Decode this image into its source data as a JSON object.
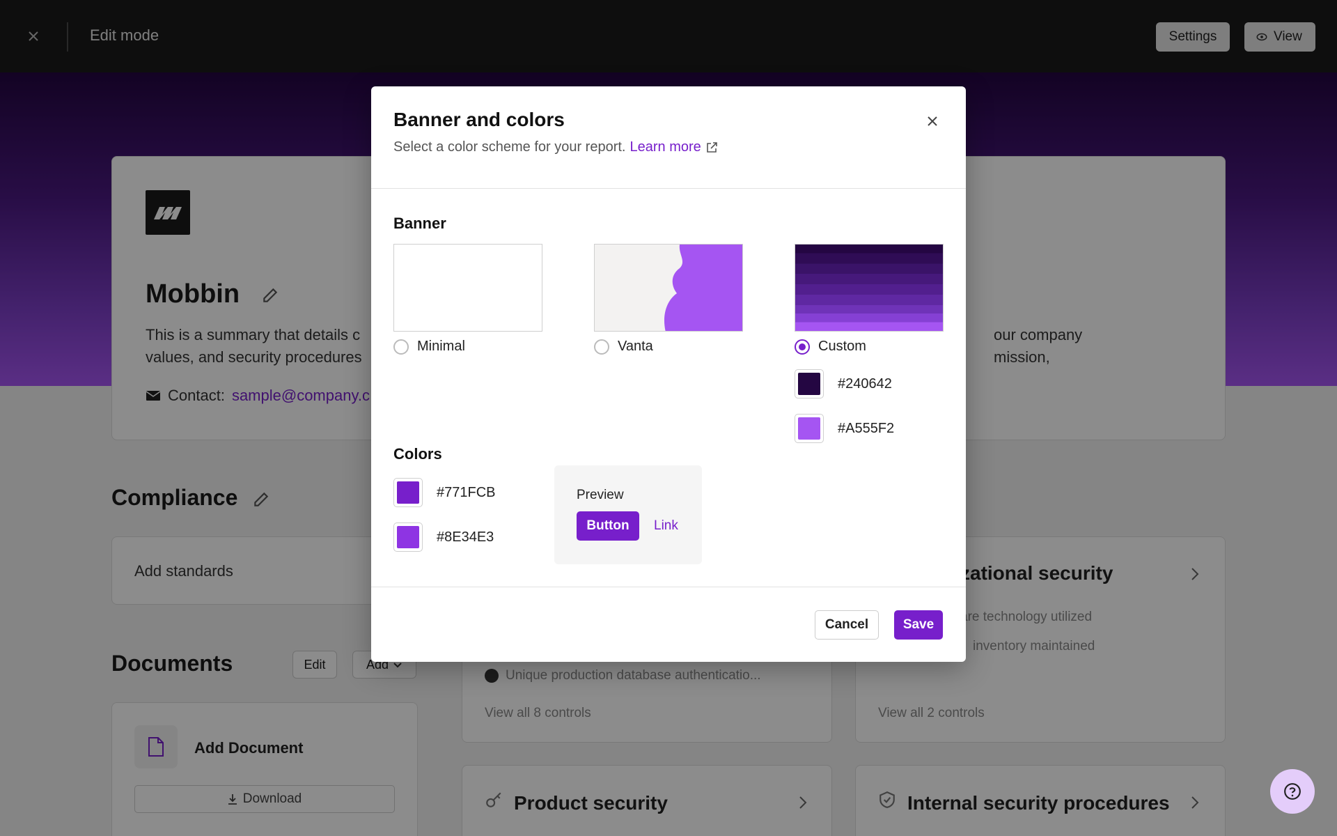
{
  "topbar": {
    "title": "Edit mode",
    "settings_label": "Settings",
    "view_label": "View"
  },
  "profile": {
    "company_name": "Mobbin",
    "summary_left": "This is a summary that details c",
    "summary_right": "our company mission,",
    "summary_line2": "values, and security procedures",
    "contact_label": "Contact:",
    "contact_email": "sample@company.c"
  },
  "compliance": {
    "title": "Compliance",
    "add_standards": "Add standards",
    "org_security_title": "zational security"
  },
  "documents": {
    "title": "Documents",
    "edit_label": "Edit",
    "add_label": "Add",
    "add_document": "Add Document",
    "download_label": "Download"
  },
  "controls": {
    "item_db": "Unique production database authenticatio...",
    "view_all_8": "View all 8 controls",
    "item_tech": "are technology utilized",
    "item_inventory": "inventory maintained",
    "view_all_2": "View all 2 controls",
    "product_security": "Product security",
    "internal_security": "Internal security procedures"
  },
  "modal": {
    "title": "Banner and colors",
    "subtitle": "Select a color scheme for your report.",
    "learn_more": "Learn more",
    "banner_label": "Banner",
    "options": [
      {
        "label": "Minimal",
        "checked": false
      },
      {
        "label": "Vanta",
        "checked": false
      },
      {
        "label": "Custom",
        "checked": true
      }
    ],
    "banner_colors": [
      {
        "hex_label": "#240642",
        "color": "#240642"
      },
      {
        "hex_label": "#A555F2",
        "color": "#A555F2"
      }
    ],
    "colors_label": "Colors",
    "colors": [
      {
        "hex_label": "#771FCB",
        "color": "#771FCB"
      },
      {
        "hex_label": "#8E34E3",
        "color": "#8E34E3"
      }
    ],
    "preview_label": "Preview",
    "preview_button": "Button",
    "preview_link": "Link",
    "cancel_label": "Cancel",
    "save_label": "Save"
  },
  "theme": {
    "accent": "#771fcb",
    "vanta_purple": "#a555f2"
  }
}
